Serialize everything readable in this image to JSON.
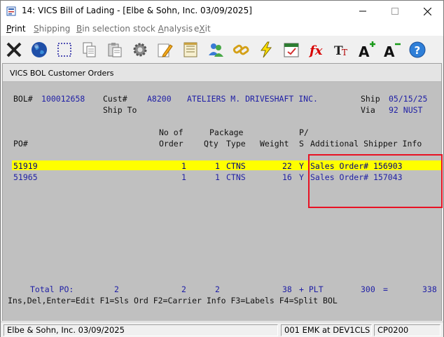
{
  "window": {
    "title": "14: VICS Bill of Lading - [Elbe & Sohn, Inc. 03/09/2025]",
    "minimize": "—",
    "maximize": "☐",
    "close": "✕"
  },
  "menu": {
    "print": "Print",
    "shipping": "Shipping",
    "bin": "Bin selection",
    "stock": "stock Analysis",
    "exit": "eXit"
  },
  "toolbar": {
    "icons": [
      "cancel-icon",
      "globe-icon",
      "select-icon",
      "copy-icon",
      "paste-icon",
      "settings-icon",
      "edit-icon",
      "notes-icon",
      "users-icon",
      "link-icon",
      "lightning-icon",
      "calendar-icon",
      "function-icon",
      "font-icon",
      "zoom-in-icon",
      "zoom-out-icon",
      "help-icon"
    ]
  },
  "child": {
    "title": "VICS BOL Customer Orders"
  },
  "header": {
    "bol_label": "BOL#",
    "bol_value": "100012658",
    "cust_label": "Cust#",
    "cust_value": "A8200",
    "customer_name": "ATELIERS M. DRIVESHAFT INC.",
    "ship_label": "Ship",
    "ship_date": "05/15/25",
    "ship_to_label": "Ship To",
    "via_label": "Via",
    "via_value": "92 NUST"
  },
  "columns": {
    "no_of": "No of",
    "package": "Package",
    "ps_top": "P/",
    "po": "PO#",
    "order": "Order",
    "qty": "Qty",
    "type": "Type",
    "weight": "Weight",
    "ps_bottom": "S",
    "additional": "Additional Shipper Info"
  },
  "rows": [
    {
      "po": "51919",
      "order": "1",
      "qty": "1",
      "type": "CTNS",
      "weight": "22",
      "ps": "Y",
      "info": "Sales Order# 156903"
    },
    {
      "po": "51965",
      "order": "1",
      "qty": "1",
      "type": "CTNS",
      "weight": "16",
      "ps": "Y",
      "info": "Sales Order# 157043"
    }
  ],
  "totals": {
    "label": "Total PO:",
    "po_count": "2",
    "orders": "2",
    "qty": "2",
    "weight": "38",
    "plus_plt": "+ PLT",
    "plt": "300",
    "equals": "=",
    "grand": "338"
  },
  "help_line": "Ins,Del,Enter=Edit F1=Sls Ord F2=Carrier Info F3=Labels F4=Split BOL",
  "status": {
    "company": "Elbe & Sohn, Inc. 03/09/2025",
    "user": "001 EMK at DEV1CLS",
    "program": "CP0200"
  }
}
